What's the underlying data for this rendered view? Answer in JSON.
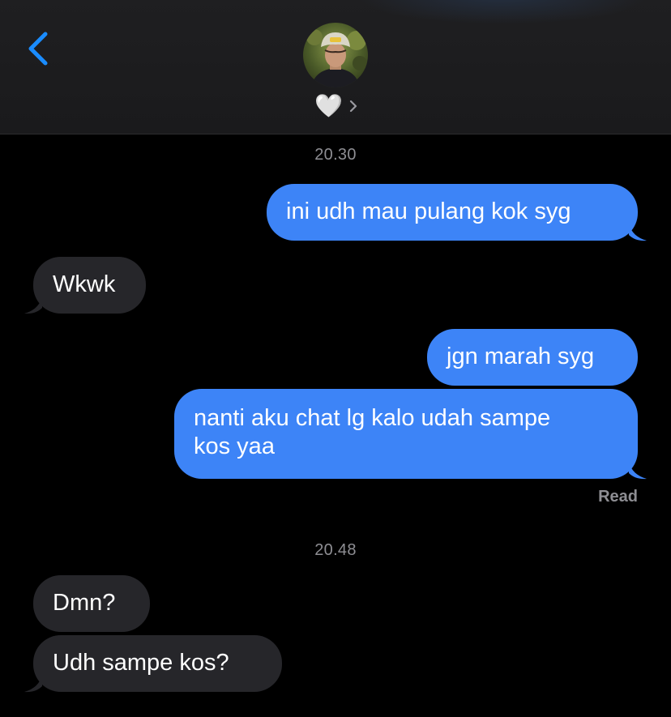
{
  "header": {
    "contact_name": "🤍",
    "back_icon": "chevron-left-icon",
    "detail_icon": "chevron-right-icon"
  },
  "colors": {
    "outgoing_bubble": "#3d84f7",
    "incoming_bubble": "#26262a",
    "accent": "#1a8cff",
    "timestamp": "#8e8e93"
  },
  "conversation": {
    "groups": [
      {
        "time": "20.30"
      },
      {
        "time": "20.48"
      }
    ],
    "messages": [
      {
        "direction": "out",
        "text": "ini udh mau pulang kok syg"
      },
      {
        "direction": "in",
        "text": "Wkwk"
      },
      {
        "direction": "out",
        "text": "jgn marah syg"
      },
      {
        "direction": "out",
        "text": "nanti aku chat lg kalo udah sampe\nkos yaa"
      },
      {
        "direction": "in",
        "text": "Dmn?"
      },
      {
        "direction": "in",
        "text": "Udh sampe kos?"
      }
    ],
    "read_receipt": "Read"
  }
}
